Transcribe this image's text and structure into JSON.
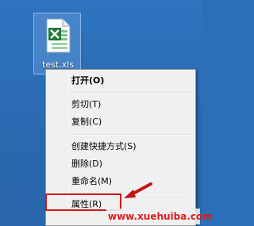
{
  "desktop": {
    "file": {
      "name": "test.xls",
      "icon": "excel-file-icon"
    }
  },
  "context_menu": {
    "items": [
      {
        "label": "打开(O)",
        "bold": true
      },
      {
        "label": "剪切(T)"
      },
      {
        "label": "复制(C)"
      },
      {
        "label": "创建快捷方式(S)"
      },
      {
        "label": "删除(D)"
      },
      {
        "label": "重命名(M)"
      },
      {
        "label": "属性(R)"
      }
    ]
  },
  "annotation": {
    "highlight_color": "#d01818",
    "arrow_icon": "red-arrow-icon"
  },
  "watermark": {
    "text": "www.xuehuiba.com"
  }
}
